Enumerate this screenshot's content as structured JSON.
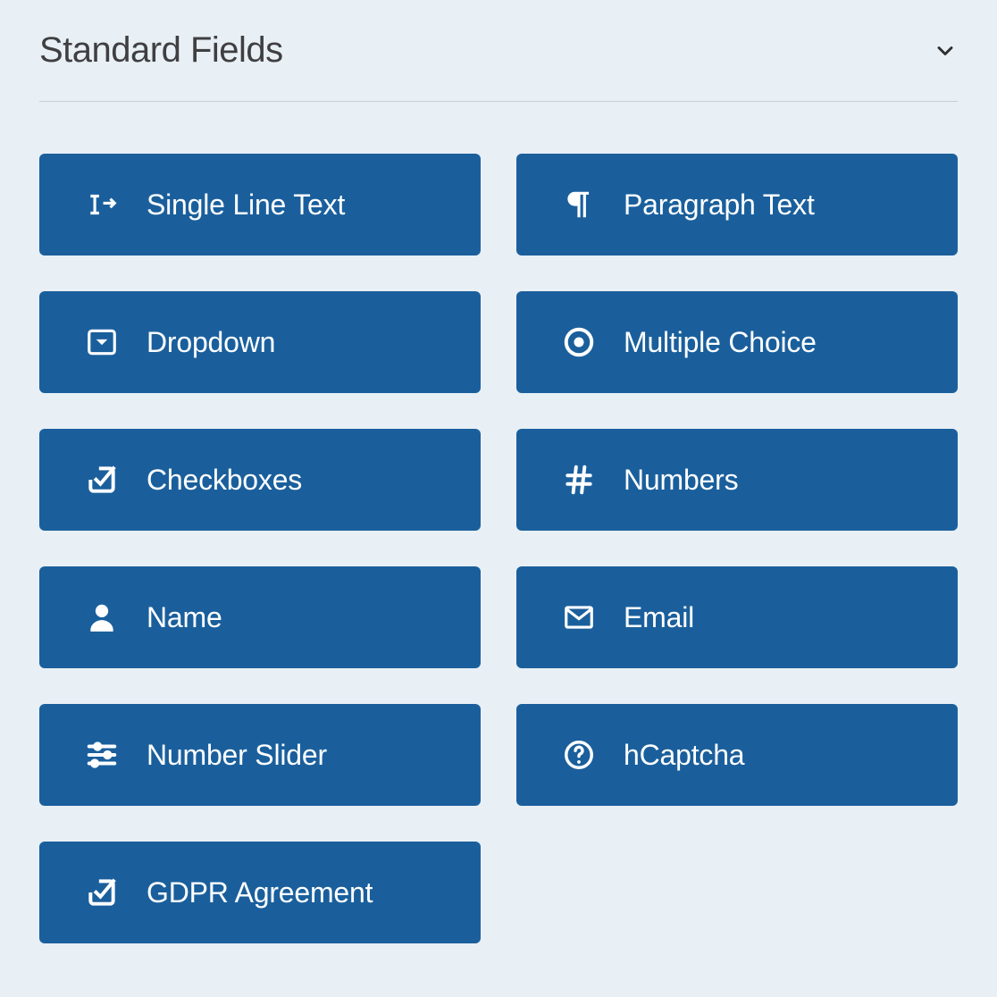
{
  "section": {
    "title": "Standard Fields"
  },
  "fields": {
    "single_line_text": "Single Line Text",
    "paragraph_text": "Paragraph Text",
    "dropdown": "Dropdown",
    "multiple_choice": "Multiple Choice",
    "checkboxes": "Checkboxes",
    "numbers": "Numbers",
    "name": "Name",
    "email": "Email",
    "number_slider": "Number Slider",
    "hcaptcha": "hCaptcha",
    "gdpr_agreement": "GDPR Agreement"
  }
}
